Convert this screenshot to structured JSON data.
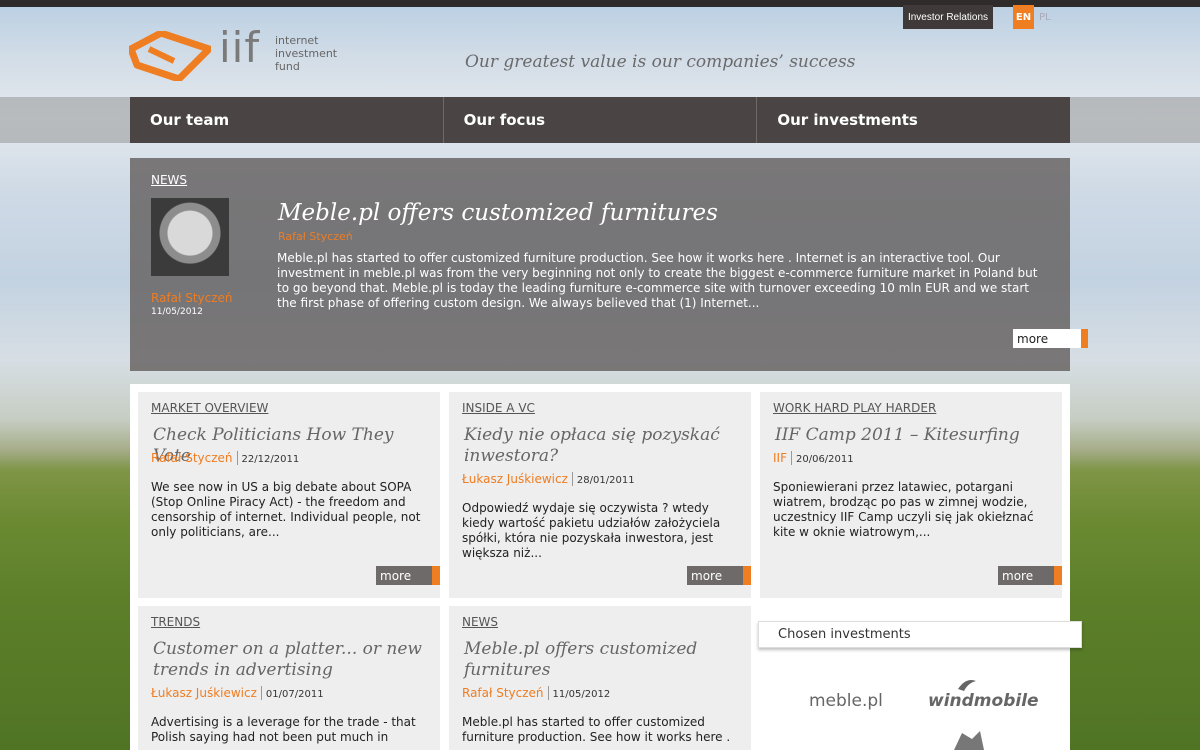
{
  "header": {
    "logo_text": [
      "internet",
      "investment",
      "fund"
    ],
    "logo_iif": "iif",
    "tagline": "Our greatest value is our companies’ success",
    "investor_relations": "Investor Relations",
    "lang_en": "EN",
    "lang_pl": "PL"
  },
  "nav": [
    "Our team",
    "Our focus",
    "Our investments"
  ],
  "hero": {
    "label": "NEWS",
    "title": "Meble.pl offers customized furnitures",
    "subtitle": "Rafał Styczeń",
    "author": "Rafał Styczeń",
    "date": "11/05/2012",
    "body": "Meble.pl  has started to offer customized furniture production. See how it works  here . Internet is an interactive tool. Our investment in meble.pl was from the very beginning not only to create the biggest e-commerce furniture market in Poland but to go beyond that. Meble.pl is today the leading furniture e-commerce site with turnover exceeding 10 mln EUR and we start the first phase of offering custom design. We always believed that (1) Internet...",
    "more": "more"
  },
  "cards": [
    {
      "label": "MARKET OVERVIEW",
      "title": "Check Politicians How They Vote",
      "author": "Rafał Styczeń",
      "date": "22/12/2011",
      "body": "We see now in US a big debate about SOPA (Stop Online Piracy Act) - the freedom and censorship of internet. Individual people, not only politicians, are...",
      "more": "more"
    },
    {
      "label": "INSIDE A VC",
      "title": "Kiedy nie opłaca się pozyskać inwestora?",
      "author": "Łukasz Juśkiewicz",
      "date": "28/01/2011",
      "body": "Odpowiedź wydaje się oczywista ? wtedy kiedy wartość pakietu udziałów założyciela spółki, która nie pozyskała inwestora, jest większa niż...",
      "more": "more"
    },
    {
      "label": "WORK HARD PLAY HARDER",
      "title": "IIF Camp 2011 – Kitesurfing",
      "author": "IIF",
      "date": "20/06/2011",
      "body": "Sponiewierani przez latawiec, potargani wiatrem, brodząc po pas w zimnej wodzie, uczestnicy IIF Camp uczyli się jak okiełznać kite w oknie wiatrowym,...",
      "more": "more"
    },
    {
      "label": "TRENDS",
      "title": "Customer on a platter... or new trends in advertising",
      "author": "Łukasz Juśkiewicz",
      "date": "01/07/2011",
      "body": "  Advertising is a leverage for the trade - that Polish saying had not been put much in"
    },
    {
      "label": "NEWS",
      "title": "Meble.pl offers customized furnitures",
      "author": "Rafał Styczeń",
      "date": "11/05/2012",
      "body": "Meble.pl  has started to offer customized furniture production. See how it works  here ."
    }
  ],
  "chosen": {
    "title": "Chosen investments",
    "logos": [
      "meble.pl",
      "windmobile"
    ]
  },
  "colors": {
    "accent": "#ef7d22",
    "nav_bg": "#4a4544"
  }
}
